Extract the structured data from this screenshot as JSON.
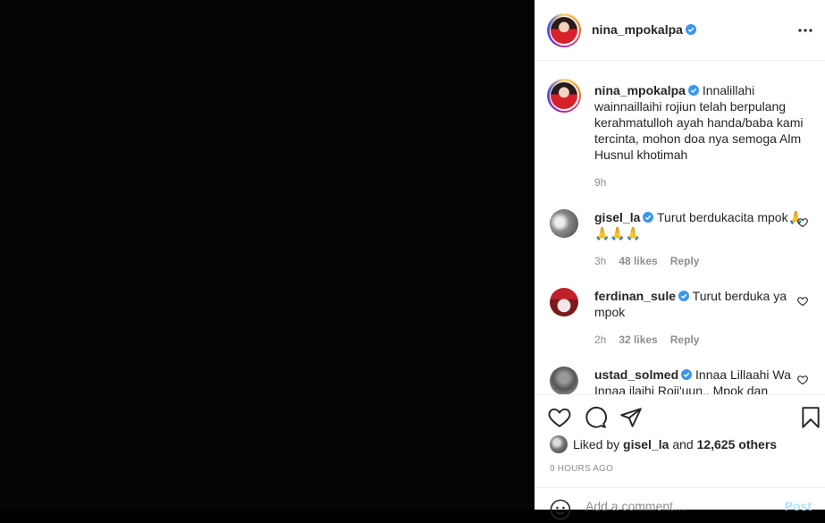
{
  "post": {
    "username": "nina_mpokalpa",
    "verified": true,
    "caption": "Innalillahi wainnaillaihi rojiun telah berpulang kerahmatulloh ayah handa/baba kami tercinta, mohon doa nya semoga Alm Husnul khotimah",
    "caption_time": "9h"
  },
  "comments": [
    {
      "username": "gisel_la",
      "verified": true,
      "text": "Turut berdukacita mpok🙏🙏🙏🙏",
      "time": "3h",
      "likes": "48 likes",
      "reply": "Reply"
    },
    {
      "username": "ferdinan_sule",
      "verified": true,
      "text": "Turut berduka ya mpok",
      "time": "2h",
      "likes": "32 likes",
      "reply": "Reply"
    },
    {
      "username": "ustad_solmed",
      "verified": true,
      "text": "Innaa Lillaahi Wa Innaa ilaihi Roji'uun.. Mpok dan",
      "time": "",
      "likes": "",
      "reply": ""
    }
  ],
  "liked_by": {
    "prefix": "Liked by",
    "user": "gisel_la",
    "and": "and",
    "others": "12,625 others"
  },
  "time_ago": "9 HOURS AGO",
  "add_comment": {
    "placeholder": "Add a comment…",
    "post_label": "Post"
  },
  "colors": {
    "verified_blue": "#3897f0",
    "text": "#262626",
    "muted": "#8e8e8e",
    "post_disabled": "#b2dffc"
  },
  "icons": [
    "more-icon",
    "heart-icon",
    "comment-icon",
    "share-icon",
    "bookmark-icon",
    "emoji-icon",
    "verified-icon"
  ]
}
